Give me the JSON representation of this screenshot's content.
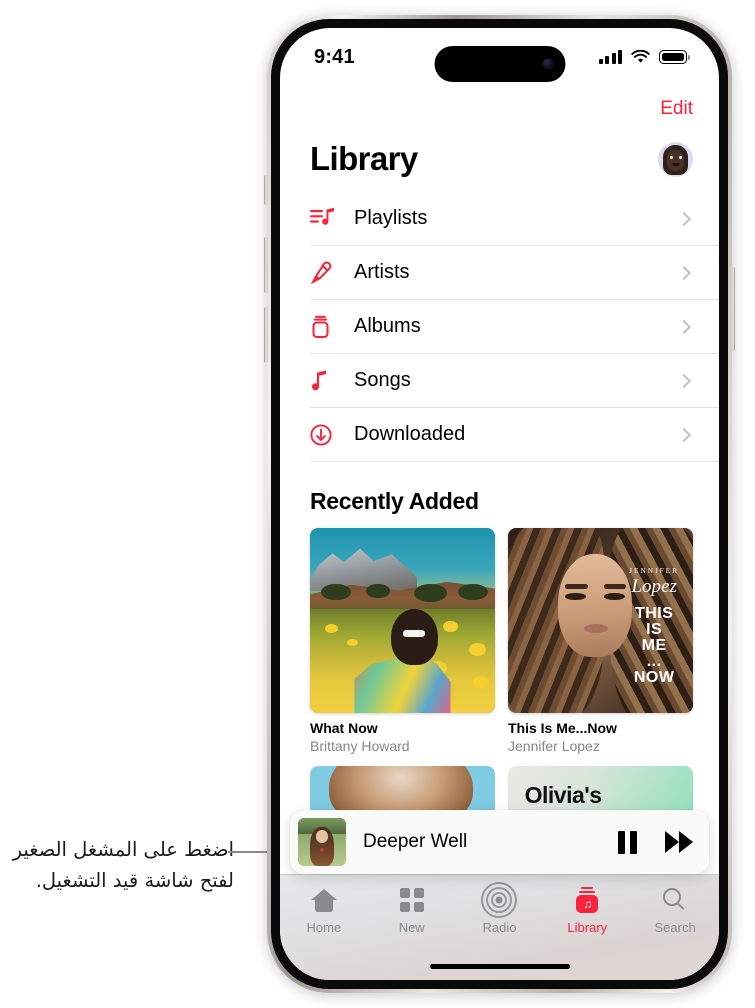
{
  "annotation": {
    "text": "اضغط على المشغل الصغير لفتح شاشة قيد التشغيل."
  },
  "status_bar": {
    "time": "9:41",
    "cellular_icon": "signal-bars-icon",
    "wifi_icon": "wifi-icon",
    "battery_icon": "battery-full-icon"
  },
  "nav": {
    "edit_label": "Edit",
    "title": "Library",
    "avatar_icon": "memoji-avatar"
  },
  "library_items": [
    {
      "label": "Playlists",
      "icon": "playlists-icon",
      "chevron": "chevron-right-icon"
    },
    {
      "label": "Artists",
      "icon": "microphone-icon",
      "chevron": "chevron-right-icon"
    },
    {
      "label": "Albums",
      "icon": "albums-icon",
      "chevron": "chevron-right-icon"
    },
    {
      "label": "Songs",
      "icon": "music-note-icon",
      "chevron": "chevron-right-icon"
    },
    {
      "label": "Downloaded",
      "icon": "download-icon",
      "chevron": "chevron-right-icon"
    }
  ],
  "recently_added": {
    "section_title": "Recently Added",
    "albums": [
      {
        "title": "What Now",
        "artist": "Brittany Howard"
      },
      {
        "title": "This Is Me...Now",
        "artist": "Jennifer Lopez"
      }
    ],
    "album2_art_text": {
      "artist_small": "JENNIFER",
      "script": "Lopez",
      "line1": "THIS",
      "line2": "IS",
      "line3": "ME",
      "line4": "...",
      "line5": "NOW"
    },
    "next_row": {
      "right_title": "Olivia's"
    }
  },
  "mini_player": {
    "track_title": "Deeper Well",
    "artwork_icon": "album-artwork",
    "pause_icon": "pause-icon",
    "next_icon": "fast-forward-icon"
  },
  "tab_bar": {
    "tabs": [
      {
        "label": "Home",
        "icon": "home-icon",
        "active": false
      },
      {
        "label": "New",
        "icon": "grid-icon",
        "active": false
      },
      {
        "label": "Radio",
        "icon": "radio-icon",
        "active": false
      },
      {
        "label": "Library",
        "icon": "library-icon",
        "active": true
      },
      {
        "label": "Search",
        "icon": "search-icon",
        "active": false
      }
    ]
  },
  "colors": {
    "accent_red": "#fa233b",
    "inactive_gray": "#8a8a8e",
    "separator": "#e3e3e5",
    "secondary_text": "#86868b"
  }
}
